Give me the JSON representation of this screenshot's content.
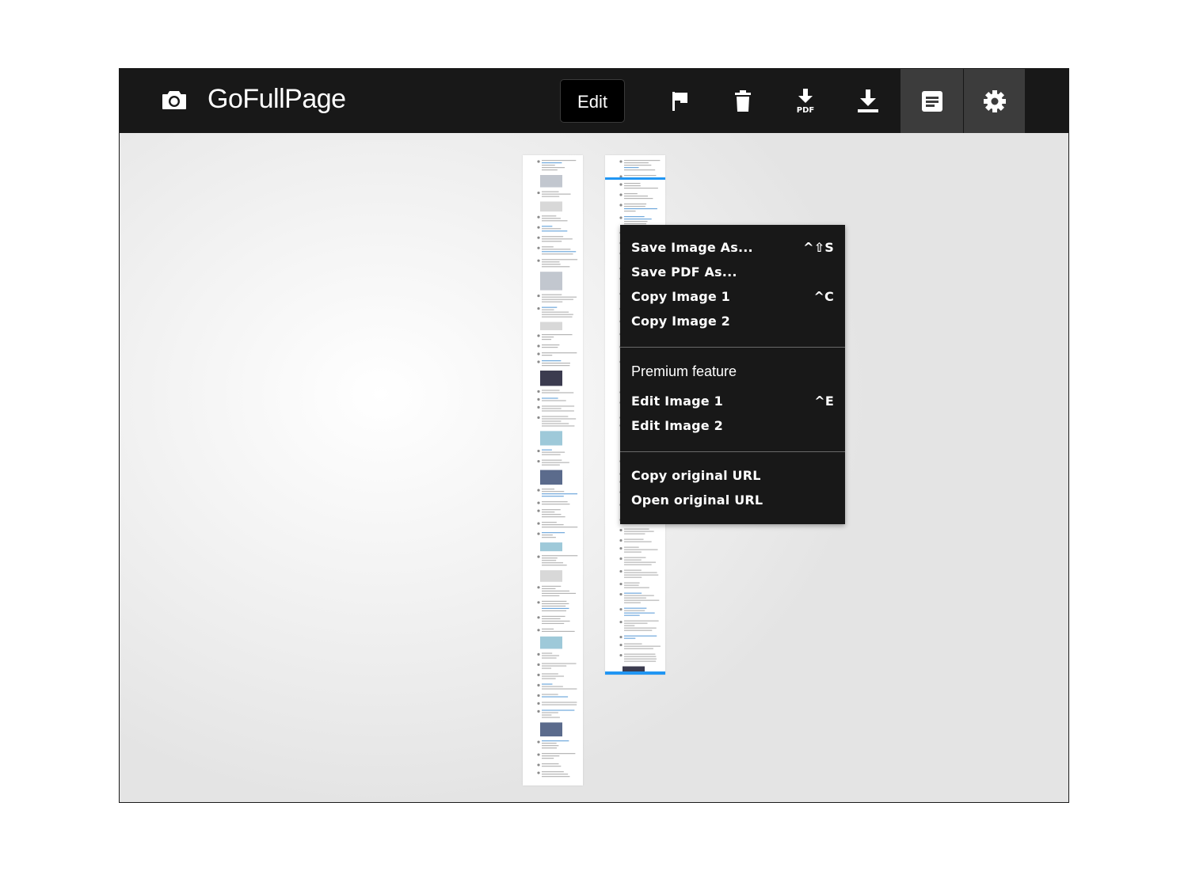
{
  "app": {
    "title": "GoFullPage",
    "logo_icon": "camera-icon"
  },
  "toolbar": {
    "edit_label": "Edit",
    "buttons": [
      {
        "name": "flag-button",
        "icon": "flag-icon"
      },
      {
        "name": "delete-button",
        "icon": "trash-icon"
      },
      {
        "name": "download-pdf-button",
        "icon": "download-pdf-icon",
        "icon_text": "PDF"
      },
      {
        "name": "download-button",
        "icon": "download-icon"
      },
      {
        "name": "options-button",
        "icon": "document-icon",
        "active": true
      },
      {
        "name": "settings-button",
        "icon": "gear-icon",
        "active": true
      }
    ]
  },
  "menu": {
    "section1": {
      "save_image": {
        "label": "Save Image As...",
        "shortcut": "^⇧S"
      },
      "save_pdf": {
        "label": "Save PDF As..."
      },
      "copy_image_1": {
        "label": "Copy Image 1",
        "shortcut": "^C"
      },
      "copy_image_2": {
        "label": "Copy Image 2"
      }
    },
    "section2": {
      "heading": "Premium feature",
      "edit_image_1": {
        "label": "Edit Image 1",
        "shortcut": "^E"
      },
      "edit_image_2": {
        "label": "Edit Image 2"
      }
    },
    "section3": {
      "copy_url": {
        "label": "Copy original URL"
      },
      "open_url": {
        "label": "Open original URL"
      }
    }
  },
  "colors": {
    "topbar": "#181818",
    "active_button": "#3c3c3c",
    "menu_bg": "#181818",
    "accent_blue": "#2196f3"
  }
}
